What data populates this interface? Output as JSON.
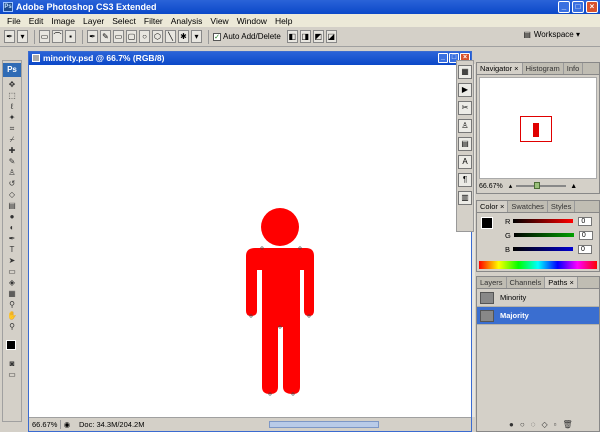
{
  "window": {
    "title": "Adobe Photoshop CS3 Extended",
    "ps_badge": "Ps"
  },
  "menu": [
    "File",
    "Edit",
    "Image",
    "Layer",
    "Select",
    "Filter",
    "Analysis",
    "View",
    "Window",
    "Help"
  ],
  "options_bar": {
    "auto_add_delete_label": "Auto Add/Delete",
    "workspace_label": "Workspace ▾"
  },
  "document": {
    "title": "minority.psd @ 66.7% (RGB/8)",
    "zoom": "66.67%",
    "doc_size": "Doc: 34.3M/204.2M",
    "figure_color": "#ff0000"
  },
  "navigator": {
    "tabs": [
      "Navigator ×",
      "Histogram",
      "Info"
    ],
    "zoom": "66.67%"
  },
  "color_panel": {
    "tabs": [
      "Color ×",
      "Swatches",
      "Styles"
    ],
    "r_label": "R",
    "g_label": "G",
    "b_label": "B",
    "r_value": "0",
    "g_value": "0",
    "b_value": "0"
  },
  "paths_panel": {
    "tabs": [
      "Layers",
      "Channels",
      "Paths ×"
    ],
    "items": [
      {
        "label": "Minority",
        "selected": false
      },
      {
        "label": "Majority",
        "selected": true
      }
    ]
  }
}
